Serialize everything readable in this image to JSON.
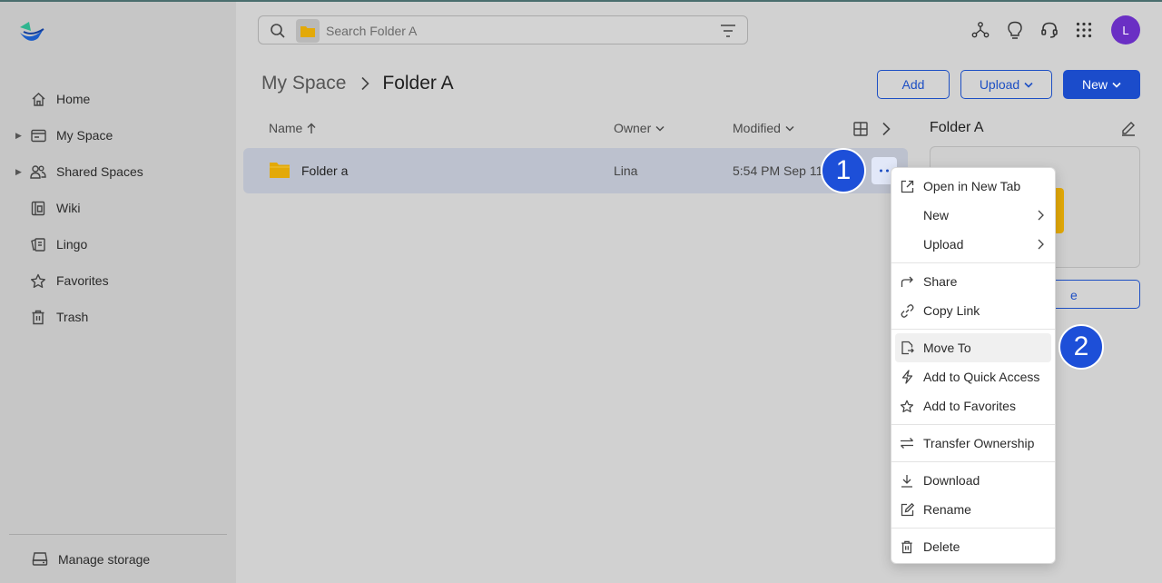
{
  "sidebar": {
    "items": [
      {
        "label": "Home",
        "icon": "home-icon",
        "expandable": false
      },
      {
        "label": "My Space",
        "icon": "folder-icon",
        "expandable": true
      },
      {
        "label": "Shared Spaces",
        "icon": "people-icon",
        "expandable": true
      },
      {
        "label": "Wiki",
        "icon": "wiki-icon",
        "expandable": false
      },
      {
        "label": "Lingo",
        "icon": "lingo-icon",
        "expandable": false
      },
      {
        "label": "Favorites",
        "icon": "star-icon",
        "expandable": false
      },
      {
        "label": "Trash",
        "icon": "trash-icon",
        "expandable": false
      }
    ],
    "manage_storage": "Manage storage"
  },
  "search": {
    "placeholder": "Search Folder A"
  },
  "header": {
    "avatar_initial": "L"
  },
  "breadcrumb": {
    "parent": "My Space",
    "current": "Folder A"
  },
  "toolbar": {
    "add_label": "Add",
    "upload_label": "Upload",
    "new_label": "New"
  },
  "table": {
    "columns": {
      "name": "Name",
      "owner": "Owner",
      "modified": "Modified"
    },
    "rows": [
      {
        "name": "Folder a",
        "owner": "Lina",
        "modified": "5:54 PM Sep 11"
      }
    ]
  },
  "details": {
    "title": "Folder A",
    "button_fragment": "e"
  },
  "context_menu": {
    "items": [
      {
        "label": "Open in New Tab",
        "icon": "open-external-icon"
      },
      {
        "label": "New",
        "icon": "",
        "submenu": true
      },
      {
        "label": "Upload",
        "icon": "",
        "submenu": true
      },
      {
        "label": "Share",
        "icon": "share-icon"
      },
      {
        "label": "Copy Link",
        "icon": "link-icon"
      },
      {
        "label": "Move To",
        "icon": "move-icon",
        "highlighted": true
      },
      {
        "label": "Add to Quick Access",
        "icon": "lightning-icon"
      },
      {
        "label": "Add to Favorites",
        "icon": "star-icon"
      },
      {
        "label": "Transfer Ownership",
        "icon": "transfer-icon"
      },
      {
        "label": "Download",
        "icon": "download-icon"
      },
      {
        "label": "Rename",
        "icon": "rename-icon"
      },
      {
        "label": "Delete",
        "icon": "trash-icon"
      }
    ]
  },
  "annotations": {
    "step1": "1",
    "step2": "2"
  },
  "colors": {
    "accent": "#1b4ccb",
    "folder": "#e3a908",
    "avatar": "#6a2fc4",
    "step_marker": "#1d4fd8"
  }
}
